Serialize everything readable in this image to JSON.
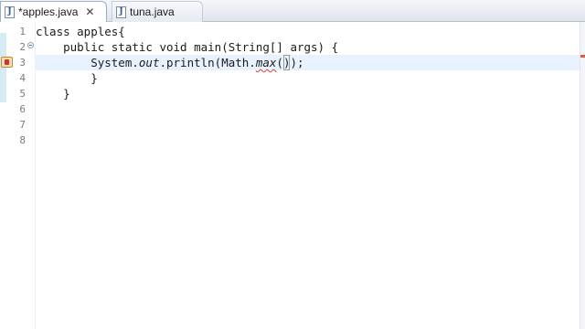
{
  "tabs": [
    {
      "label": "*apples.java",
      "active": true,
      "close": "✕"
    },
    {
      "label": "tuna.java",
      "active": false
    }
  ],
  "editor": {
    "line_numbers": [
      "1",
      "2",
      "3",
      "4",
      "5",
      "6",
      "7",
      "8"
    ],
    "code": {
      "line1": "class apples{",
      "line2": "    public static void main(String[] args) {",
      "line3_prefix": "        System.",
      "line3_out": "out",
      "line3_mid": ".println(Math.",
      "line3_max": "max",
      "line3_open": "(",
      "line3_close": ")",
      "line3_end": ");",
      "line4": "        }",
      "line5": "    }"
    },
    "active_line": 3,
    "colors": {
      "current_line": "#e8f2fe",
      "error": "#e03a2e"
    }
  }
}
